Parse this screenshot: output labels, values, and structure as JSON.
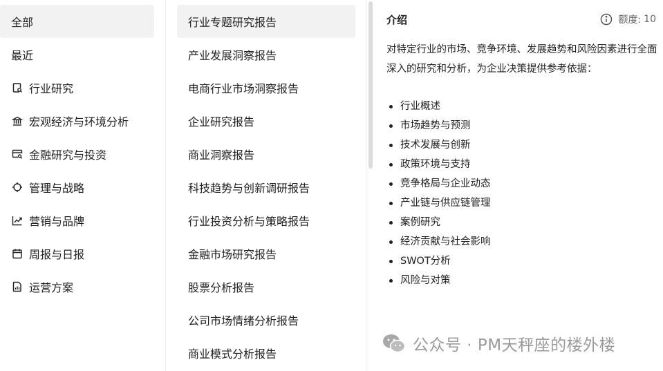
{
  "categories": [
    {
      "label": "全部",
      "icon": "",
      "active": true
    },
    {
      "label": "最近",
      "icon": "",
      "active": false
    },
    {
      "label": "行业研究",
      "icon": "document-search-icon",
      "active": false
    },
    {
      "label": "宏观经济与环境分析",
      "icon": "bank-icon",
      "active": false
    },
    {
      "label": "金融研究与投资",
      "icon": "card-search-icon",
      "active": false
    },
    {
      "label": "管理与战略",
      "icon": "crosshair-icon",
      "active": false
    },
    {
      "label": "营销与品牌",
      "icon": "trend-chart-icon",
      "active": false
    },
    {
      "label": "周报与日报",
      "icon": "calendar-icon",
      "active": false
    },
    {
      "label": "运营方案",
      "icon": "report-file-icon",
      "active": false
    }
  ],
  "templates": [
    {
      "label": "行业专题研究报告",
      "active": true
    },
    {
      "label": "产业发展洞察报告",
      "active": false
    },
    {
      "label": "电商行业市场洞察报告",
      "active": false
    },
    {
      "label": "企业研究报告",
      "active": false
    },
    {
      "label": "商业洞察报告",
      "active": false
    },
    {
      "label": "科技趋势与创新调研报告",
      "active": false
    },
    {
      "label": "行业投资分析与策略报告",
      "active": false
    },
    {
      "label": "金融市场研究报告",
      "active": false
    },
    {
      "label": "股票分析报告",
      "active": false
    },
    {
      "label": "公司市场情绪分析报告",
      "active": false
    },
    {
      "label": "商业模式分析报告",
      "active": false
    }
  ],
  "detail": {
    "heading": "介绍",
    "quota_label": "额度:",
    "quota_value": "10",
    "description": "对特定行业的市场、竞争环境、发展趋势和风险因素进行全面深入的研究和分析，为企业决策提供参考依据：",
    "bullets": [
      "行业概述",
      "市场趋势与预测",
      "技术发展与创新",
      "政策环境与支持",
      "竞争格局与企业动态",
      "产业链与供应链管理",
      "案例研究",
      "经济贡献与社会影响",
      "SWOT分析",
      "风险与对策"
    ]
  },
  "watermark": {
    "text": "公众号 · PM天秤座的楼外楼",
    "icon": "wechat-icon"
  },
  "colors": {
    "active_bg": "#f2f2f2",
    "text": "#1f1f1f",
    "muted": "#666666",
    "watermark": "#9a9a9a"
  }
}
